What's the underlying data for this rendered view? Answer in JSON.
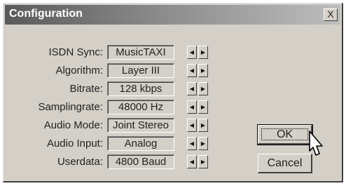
{
  "window": {
    "title": "Configuration",
    "close_glyph": "X"
  },
  "settings": [
    {
      "label": "ISDN Sync:",
      "value": "MusicTAXI"
    },
    {
      "label": "Algorithm:",
      "value": "Layer III"
    },
    {
      "label": "Bitrate:",
      "value": "128 kbps"
    },
    {
      "label": "Samplingrate:",
      "value": "48000 Hz"
    },
    {
      "label": "Audio Mode:",
      "value": "Joint Stereo"
    },
    {
      "label": "Audio Input:",
      "value": "Analog"
    },
    {
      "label": "Userdata:",
      "value": "4800 Baud"
    }
  ],
  "arrows": {
    "left": "◀",
    "right": "▶"
  },
  "buttons": {
    "ok": "OK",
    "cancel": "Cancel"
  },
  "icons": {
    "close": "close-icon",
    "cursor": "mouse-pointer-icon"
  }
}
